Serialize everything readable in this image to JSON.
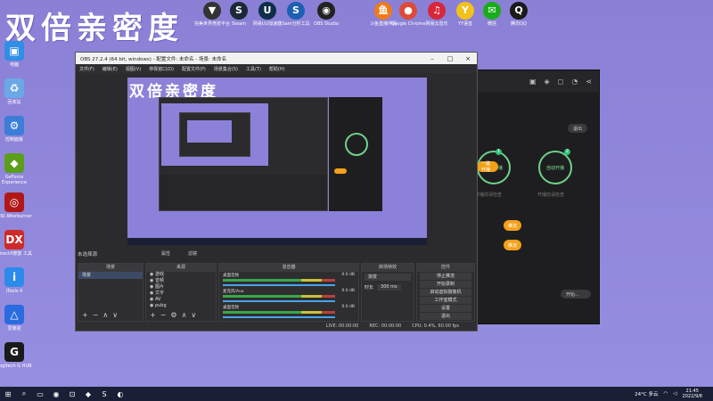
{
  "banner": "双倍亲密度",
  "desktop_icons": [
    {
      "label": "电脑",
      "glyph": "▣",
      "color": "#2f8ee6"
    },
    {
      "label": "回收站",
      "glyph": "♻",
      "color": "#6aa8e8"
    },
    {
      "label": "控制面板",
      "glyph": "⚙",
      "color": "#3b7dd8"
    },
    {
      "label": "GeForce Experience",
      "glyph": "◆",
      "color": "#5a9e1a"
    },
    {
      "label": "MSI Afterburner",
      "glyph": "◎",
      "color": "#b01818"
    },
    {
      "label": "DirectX修复 工具",
      "glyph": "DX",
      "color": "#cf2a2a"
    },
    {
      "label": "iTools 4",
      "glyph": "i",
      "color": "#2c8bea"
    },
    {
      "label": "爱彼迎",
      "glyph": "△",
      "color": "#2a6be0"
    },
    {
      "label": "Logitech G HUB",
      "glyph": "G",
      "color": "#1a1a1a"
    }
  ],
  "top_icons": [
    {
      "label": "完美世界竞技平台",
      "glyph": "▼",
      "color": "#333"
    },
    {
      "label": "Steam",
      "glyph": "S",
      "color": "#1b2838"
    },
    {
      "label": "网易UU加速器",
      "glyph": "U",
      "color": "#0e2e4a"
    },
    {
      "label": "Sam分析工具",
      "glyph": "S",
      "color": "#1d5fb3"
    },
    {
      "label": "OBS Studio",
      "glyph": "◉",
      "color": "#222"
    },
    {
      "label": "斗鱼直播伴侣",
      "glyph": "鱼",
      "color": "#f07a1a"
    },
    {
      "label": "Google Chrome",
      "glyph": "●",
      "color": "#dd4b39"
    },
    {
      "label": "网易云音乐",
      "glyph": "♫",
      "color": "#d8263a"
    },
    {
      "label": "YY语音",
      "glyph": "Y",
      "color": "#f2c11b"
    },
    {
      "label": "微信",
      "glyph": "✉",
      "color": "#1aad19"
    },
    {
      "label": "腾讯QQ",
      "glyph": "Q",
      "color": "#1a1a1a"
    }
  ],
  "dark_app": {
    "exit_label": "退出",
    "left_ring_label": "一键开播",
    "right_ring_label": "自动开播",
    "left_ring_step": "1",
    "right_ring_step": "2",
    "left_hint": "开播前请检查",
    "right_hint": "开播前请检查",
    "pill_label": "推流",
    "pill2_label": "推流",
    "bottom_button": "开始..."
  },
  "obs": {
    "title": "OBS 27.2.4 (64 bit, windows) - 配置文件: 未命名 - 场景: 未命名",
    "menu": [
      "文件(F)",
      "编辑(E)",
      "视图(V)",
      "停靠窗口(D)",
      "配置文件(P)",
      "场景集合(S)",
      "工具(T)",
      "帮助(H)"
    ],
    "preview_banner": "双倍亲密度",
    "scene_label": "未选择源",
    "scene_props": "属性",
    "scene_filters": "滤镜",
    "docks": {
      "scenes": {
        "header": "场景",
        "items": [
          "场景"
        ]
      },
      "sources": {
        "header": "来源",
        "items": [
          "游戏",
          "音频",
          "图片",
          "文字",
          "AV",
          "pubg"
        ]
      },
      "mixer": {
        "header": "混音器",
        "tracks": [
          "桌面音频",
          "麦克风/Aux",
          "桌面音频"
        ],
        "db": [
          "0.0 dB",
          "0.0 dB",
          "0.0 dB"
        ]
      },
      "transitions": {
        "header": "转场特效",
        "select": "渐变",
        "duration_label": "时长",
        "duration": "300 ms"
      },
      "controls": {
        "header": "控件",
        "buttons": [
          "停止推流",
          "开始录制",
          "启动虚拟摄像机",
          "工作室模式",
          "设置",
          "退出"
        ]
      }
    },
    "status": {
      "live": "LIVE: 00:00:00",
      "rec": "REC: 00:00:00",
      "cpu": "CPU: 0.4%, 60.00 fps"
    }
  },
  "taskbar": {
    "apps": [
      "⊞",
      "⌕",
      "▭",
      "◉",
      "⊡",
      "◆",
      "S",
      "◐"
    ],
    "weather": "24°C 多云",
    "time": "21:45",
    "date": "2022/9/8"
  }
}
